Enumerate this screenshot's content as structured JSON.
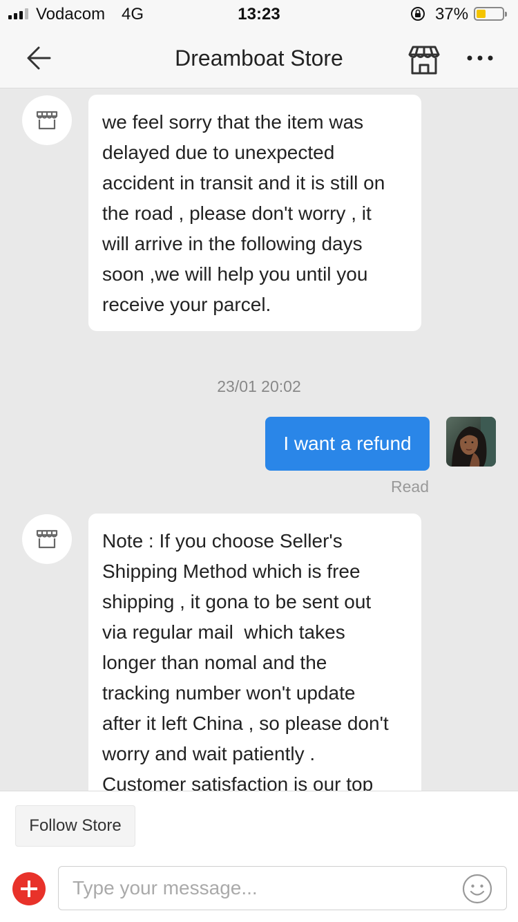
{
  "status_bar": {
    "carrier": "Vodacom",
    "network": "4G",
    "time": "13:23",
    "battery_percent": "37%",
    "battery_level": 0.37
  },
  "header": {
    "title": "Dreamboat Store",
    "back_icon": "back-arrow-icon",
    "store_icon": "storefront-icon",
    "more_icon": "more-dots-icon"
  },
  "messages": [
    {
      "sender": "store",
      "text": "we feel sorry that the item was\ndelayed due to unexpected\naccident in transit and it is still on\nthe road , please don't worry , it\nwill arrive in the following days\nsoon ,we will help you until you\nreceive your parcel."
    },
    {
      "type": "timestamp",
      "text": "23/01 20:02"
    },
    {
      "sender": "me",
      "text": "I want a refund",
      "status": "Read"
    },
    {
      "sender": "store",
      "text": "Note : If you choose Seller's\nShipping Method which is free\nshipping , it gona to be sent out\nvia regular mail  which takes\nlonger than nomal and the\ntracking number won't update\nafter it left China , so please don't\nworry and wait patiently .\nCustomer satisfaction is our top"
    }
  ],
  "footer": {
    "follow_store_label": "Follow Store",
    "input_placeholder": "Type your message...",
    "input_value": "",
    "add_icon": "add-circle-icon",
    "emoji_icon": "smiley-icon"
  },
  "colors": {
    "accent_blue": "#2a86e8",
    "add_red": "#e8322a",
    "chat_background": "#e9e9e9",
    "battery_yellow": "#f4c400"
  }
}
